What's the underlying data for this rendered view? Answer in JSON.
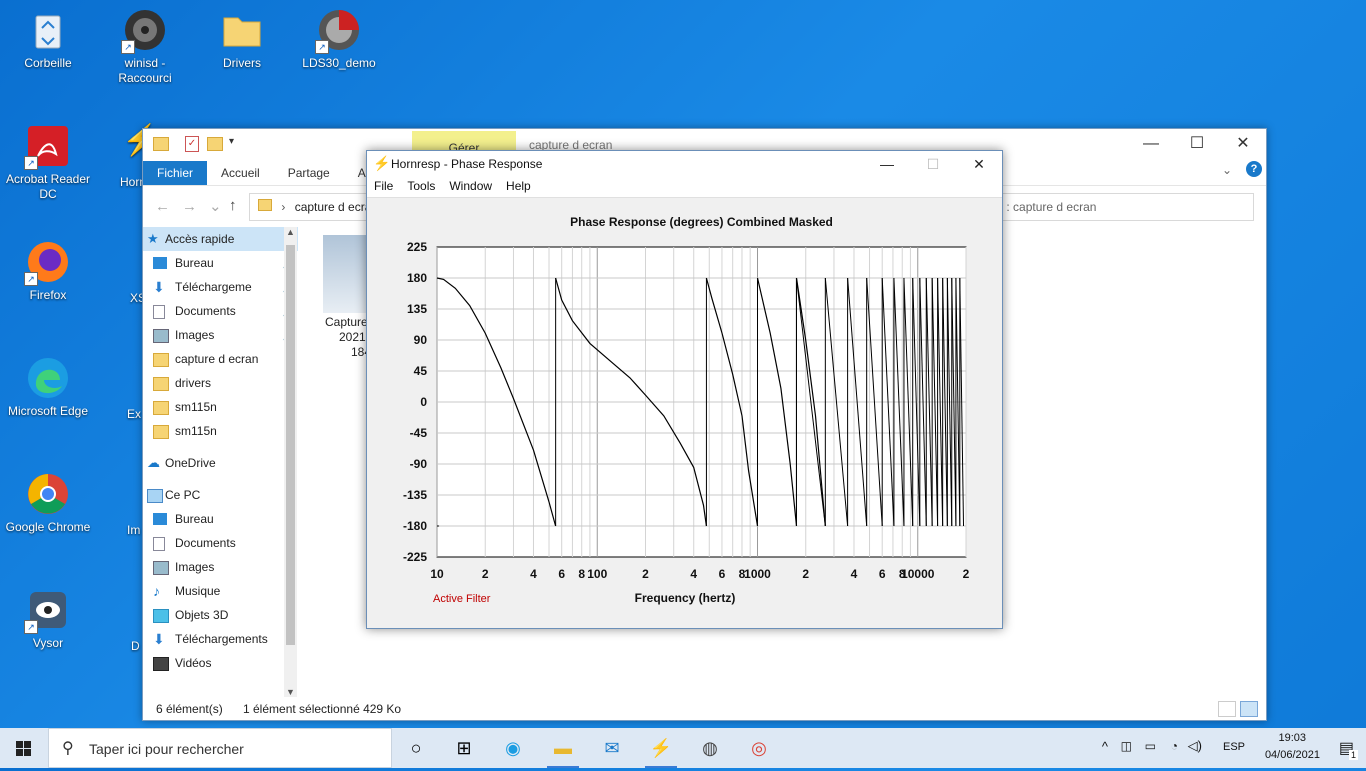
{
  "desktop": {
    "icons": [
      {
        "label": "Corbeille",
        "icon": "recycle-bin-icon"
      },
      {
        "label": "winisd - Raccourci",
        "icon": "speaker-icon"
      },
      {
        "label": "Drivers",
        "icon": "folder-icon"
      },
      {
        "label": "LDS30_demo",
        "icon": "app-icon"
      },
      {
        "label": "Acrobat Reader DC",
        "icon": "acrobat-icon"
      },
      {
        "label": "Firefox",
        "icon": "firefox-icon"
      },
      {
        "label": "Microsoft Edge",
        "icon": "edge-icon"
      },
      {
        "label": "Google Chrome",
        "icon": "chrome-icon"
      },
      {
        "label": "Vysor",
        "icon": "vysor-icon"
      }
    ],
    "partial_labels": [
      "Horn",
      "XS",
      "Ex",
      "Im",
      "D"
    ]
  },
  "explorer": {
    "manage_tab": "Gérer",
    "title": "capture d ecran",
    "ribbon_tabs": [
      "Fichier",
      "Accueil",
      "Partage",
      "Affic"
    ],
    "address": "capture d ecran",
    "search_placeholder": "er dans : capture d ecran",
    "file_name_partial": [
      "Capture",
      "2021-",
      "184"
    ],
    "sidebar": {
      "quick_access": "Accès rapide",
      "quick_items": [
        "Bureau",
        "Téléchargeme",
        "Documents",
        "Images",
        "capture d ecran",
        "drivers",
        "sm115n",
        "sm115n"
      ],
      "onedrive": "OneDrive",
      "this_pc": "Ce PC",
      "pc_items": [
        "Bureau",
        "Documents",
        "Images",
        "Musique",
        "Objets 3D",
        "Téléchargements",
        "Vidéos"
      ]
    },
    "status": {
      "count": "6 élément(s)",
      "selected": "1 élément sélectionné  429 Ko"
    }
  },
  "hornresp": {
    "title": "Hornresp - Phase Response",
    "menu": [
      "File",
      "Tools",
      "Window",
      "Help"
    ],
    "active_filter": "Active Filter",
    "colors": {
      "plot_bg": "#ffffff",
      "curve": "#000000",
      "active_filter": "#c00000"
    }
  },
  "chart_data": {
    "type": "line",
    "title": "Phase Response (degrees)    Combined    Masked",
    "xlabel": "Frequency (hertz)",
    "ylabel": "",
    "x_scale": "log",
    "xlim": [
      10,
      20000
    ],
    "ylim": [
      -225,
      225
    ],
    "yticks": [
      225,
      180,
      135,
      90,
      45,
      0,
      -45,
      -90,
      -135,
      -180,
      -225
    ],
    "xtick_labels": [
      "10",
      "2",
      "4",
      "6",
      "8",
      "100",
      "2",
      "4",
      "6",
      "8",
      "1000",
      "2",
      "4",
      "6",
      "8",
      "10000",
      "2"
    ],
    "xtick_values": [
      10,
      20,
      40,
      60,
      80,
      100,
      200,
      400,
      600,
      800,
      1000,
      2000,
      4000,
      6000,
      8000,
      10000,
      20000
    ],
    "grid": true,
    "wrap_frequencies": [
      10.3,
      55,
      480,
      1000,
      1750,
      2650,
      3650,
      4800,
      6000,
      7100,
      8200,
      9300,
      10300,
      11300,
      12300,
      13300,
      14300,
      15300,
      16300,
      17300,
      18300,
      19300
    ],
    "series": [
      {
        "name": "",
        "segments": [
          {
            "x": [
              10,
              11,
              13,
              16,
              20,
              25,
              30,
              40,
              50,
              55
            ],
            "y": [
              180,
              178,
              165,
              140,
              100,
              50,
              5,
              -70,
              -145,
              -180
            ]
          },
          {
            "x": [
              55,
              60,
              70,
              90,
              120,
              160,
              200,
              260,
              330,
              400,
              460,
              480
            ],
            "y": [
              180,
              148,
              118,
              85,
              60,
              35,
              10,
              -20,
              -60,
              -95,
              -150,
              -180
            ]
          },
          {
            "x": [
              480,
              520,
              600,
              700,
              800,
              880,
              1000
            ],
            "y": [
              180,
              150,
              100,
              40,
              -20,
              -100,
              -180
            ]
          },
          {
            "x": [
              1000,
              1200,
              1400,
              1600,
              1750
            ],
            "y": [
              180,
              100,
              20,
              -90,
              -180
            ]
          },
          {
            "x": [
              1750,
              2000,
              2300,
              2650
            ],
            "y": [
              180,
              90,
              -20,
              -180
            ]
          }
        ]
      }
    ]
  },
  "taskbar": {
    "search_placeholder": "Taper ici pour rechercher",
    "language": "ESP",
    "time": "19:03",
    "date": "04/06/2021",
    "notification_count": "1"
  }
}
